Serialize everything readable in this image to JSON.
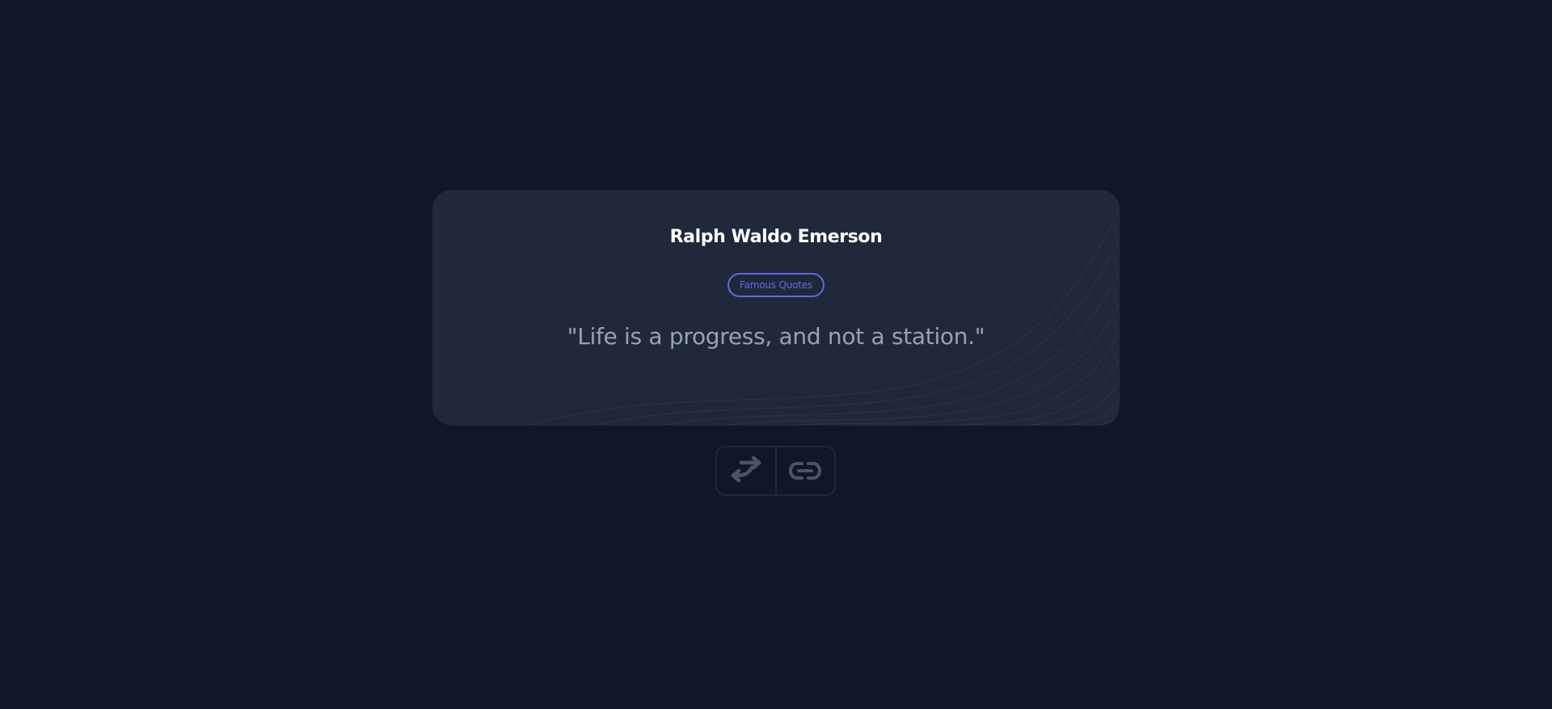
{
  "quote_card": {
    "author": "Ralph Waldo Emerson",
    "tag": "Famous Quotes",
    "quote": "\"Life is a progress, and not a station.\""
  },
  "controls": {
    "shuffle_icon": "swap-arrows-icon",
    "link_icon": "link-icon"
  },
  "colors": {
    "background": "#111729",
    "card": "#20293a",
    "accent": "#6466e9",
    "quote_text": "#97a2b5",
    "icon": "#4a5567"
  }
}
